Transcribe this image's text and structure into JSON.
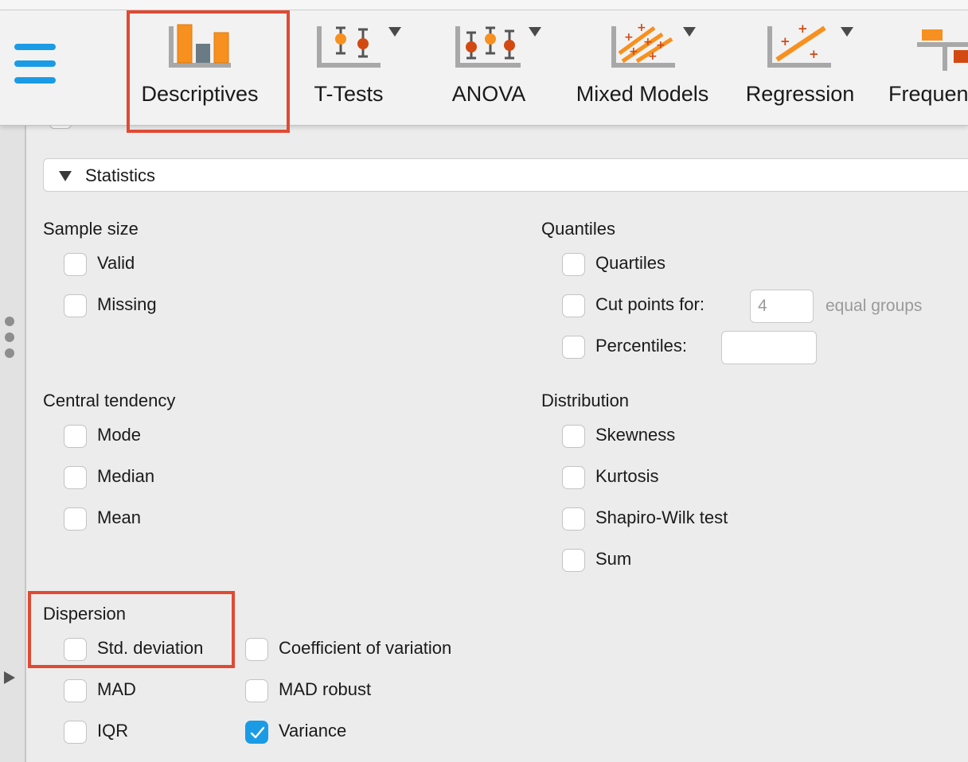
{
  "toolbar": {
    "tabs": [
      {
        "label": "Descriptives"
      },
      {
        "label": "T-Tests"
      },
      {
        "label": "ANOVA"
      },
      {
        "label": "Mixed Models"
      },
      {
        "label": "Regression"
      },
      {
        "label": "Frequen"
      }
    ]
  },
  "colors": {
    "accent": "#1a9be6",
    "highlight": "#e04a33",
    "icon_orange": "#f7901e",
    "icon_red": "#d24a12"
  },
  "statistics": {
    "header": "Statistics",
    "sample_size": {
      "title": "Sample size",
      "valid": "Valid",
      "missing": "Missing"
    },
    "quantiles": {
      "title": "Quantiles",
      "quartiles": "Quartiles",
      "cut_points": "Cut points for:",
      "cut_points_value": "4",
      "equal_groups": "equal groups",
      "percentiles": "Percentiles:",
      "percentiles_value": ""
    },
    "central_tendency": {
      "title": "Central tendency",
      "mode": "Mode",
      "median": "Median",
      "mean": "Mean"
    },
    "distribution": {
      "title": "Distribution",
      "skewness": "Skewness",
      "kurtosis": "Kurtosis",
      "shapiro": "Shapiro-Wilk test",
      "sum": "Sum"
    },
    "dispersion": {
      "title": "Dispersion",
      "std_dev": "Std. deviation",
      "coef_var": "Coefficient of variation",
      "mad": "MAD",
      "mad_robust": "MAD robust",
      "iqr": "IQR",
      "variance": "Variance",
      "variance_checked": true
    }
  }
}
